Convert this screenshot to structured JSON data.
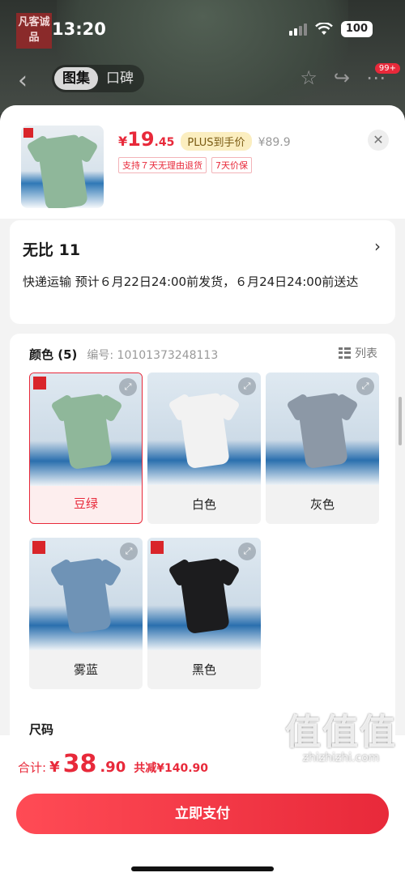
{
  "status": {
    "time": "13:20",
    "battery": "100"
  },
  "nav": {
    "tabs": [
      "图集",
      "口碑"
    ],
    "badge": "99+",
    "logo_text": "凡客诚品"
  },
  "product": {
    "price_currency": "¥",
    "price_int": "19",
    "price_dec": ".45",
    "plus_label": "PLUS到手价",
    "original_price": "¥89.9",
    "guarantees": [
      "支持７天无理由退货",
      "7天价保"
    ]
  },
  "shipping": {
    "address": "无比  11",
    "text": "快递运输  预计６月22日24:00前发货，６月24日24:00前送达"
  },
  "options": {
    "title": "颜色 (5)",
    "code": "编号:  10101373248113",
    "list_label": "列表",
    "colors": [
      {
        "label": "豆绿",
        "shirt_color": "#8fb79a",
        "selected": true
      },
      {
        "label": "白色",
        "shirt_color": "#f2f2f2",
        "selected": false
      },
      {
        "label": "灰色",
        "shirt_color": "#8c98a6",
        "selected": false
      },
      {
        "label": "雾蓝",
        "shirt_color": "#6f93b6",
        "selected": false
      },
      {
        "label": "黑色",
        "shirt_color": "#1c1c1e",
        "selected": false
      }
    ],
    "size_title": "尺码"
  },
  "footer": {
    "total_label": "合计:",
    "total_currency": "¥",
    "total_int": "38",
    "total_dec": ".90",
    "savings": "共减¥140.90",
    "pay_label": "立即支付"
  },
  "watermark": {
    "big": "值值值",
    "small": "zhizhizhi.com"
  },
  "colors": {
    "accent": "#e8293a",
    "plus_bg": "#fbeec0"
  }
}
